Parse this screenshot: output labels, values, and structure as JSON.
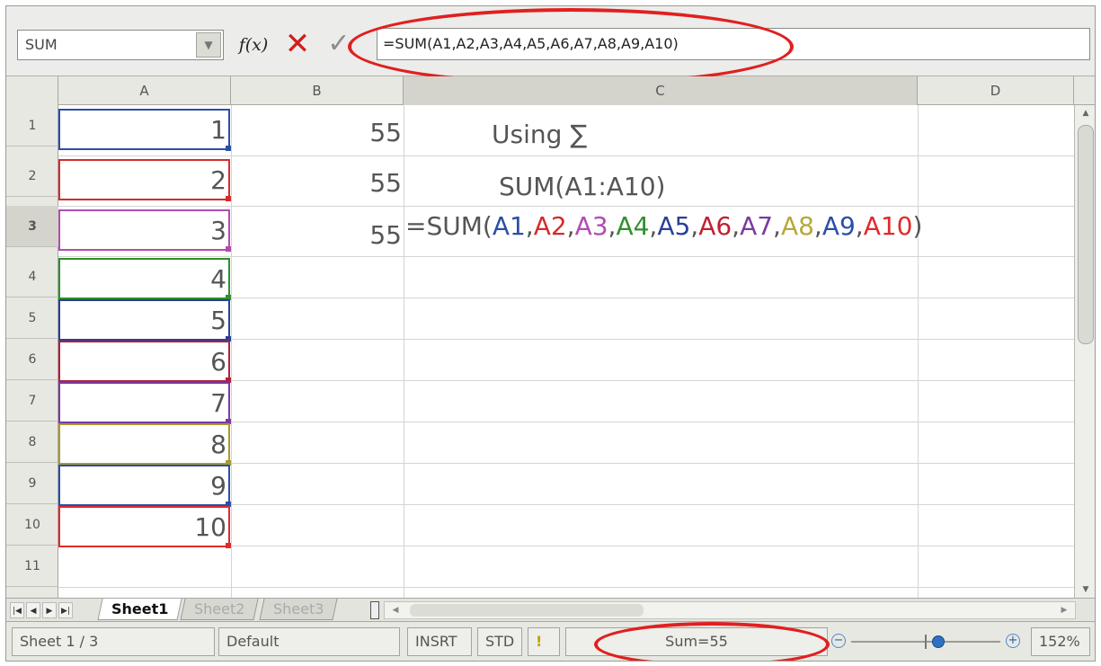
{
  "formula_bar": {
    "name_box": "SUM",
    "name_box_arrow_icon": "chevron-down-icon",
    "function_wizard_label": "f(x)",
    "cancel_icon": "x-mark-icon",
    "accept_icon": "check-mark-icon",
    "formula": "=SUM(A1,A2,A3,A4,A5,A6,A7,A8,A9,A10)"
  },
  "columns": [
    "A",
    "B",
    "C",
    "D"
  ],
  "selected_column": "C",
  "rows": [
    "1",
    "2",
    "3",
    "4",
    "5",
    "6",
    "7",
    "8",
    "9",
    "10",
    "11"
  ],
  "selected_row": "3",
  "column_a_values": [
    "1",
    "2",
    "3",
    "4",
    "5",
    "6",
    "7",
    "8",
    "9",
    "10"
  ],
  "column_a_colors": [
    "#2a4fa8",
    "#d42c2c",
    "#b04cb0",
    "#2e8f2e",
    "#2a3f98",
    "#b0203a",
    "#7a3aa0",
    "#a89a30",
    "#2a4fa8",
    "#e02a2a"
  ],
  "column_b_values": [
    "55",
    "55",
    "55"
  ],
  "column_c": {
    "row1": "Using ∑",
    "row2": "SUM(A1:A10)",
    "row3_prefix": "=SUM(",
    "row3_suffix": ")",
    "row3_refs": [
      {
        "text": "A1",
        "color": "#2a4fa8"
      },
      {
        "text": "A2",
        "color": "#d42c2c"
      },
      {
        "text": "A3",
        "color": "#b04cb0"
      },
      {
        "text": "A4",
        "color": "#2e8f2e"
      },
      {
        "text": "A5",
        "color": "#2a3f98"
      },
      {
        "text": "A6",
        "color": "#c02030"
      },
      {
        "text": "A7",
        "color": "#7a3aa0"
      },
      {
        "text": "A8",
        "color": "#b8a838"
      },
      {
        "text": "A9",
        "color": "#2a4fa8"
      },
      {
        "text": "A10",
        "color": "#e02a2a"
      }
    ]
  },
  "sheet_tabs": [
    "Sheet1",
    "Sheet2",
    "Sheet3"
  ],
  "active_sheet": "Sheet1",
  "status_bar": {
    "sheet_position": "Sheet 1 / 3",
    "page_style": "Default",
    "insert_mode": "INSRT",
    "selection_mode": "STD",
    "modified_indicator": "!",
    "sum_display": "Sum=55",
    "zoom_level": "152%",
    "zoom_minus_label": "−",
    "zoom_plus_label": "+"
  },
  "colors": {
    "highlight_circle": "#e02020",
    "cancel_red": "#cc2020"
  }
}
